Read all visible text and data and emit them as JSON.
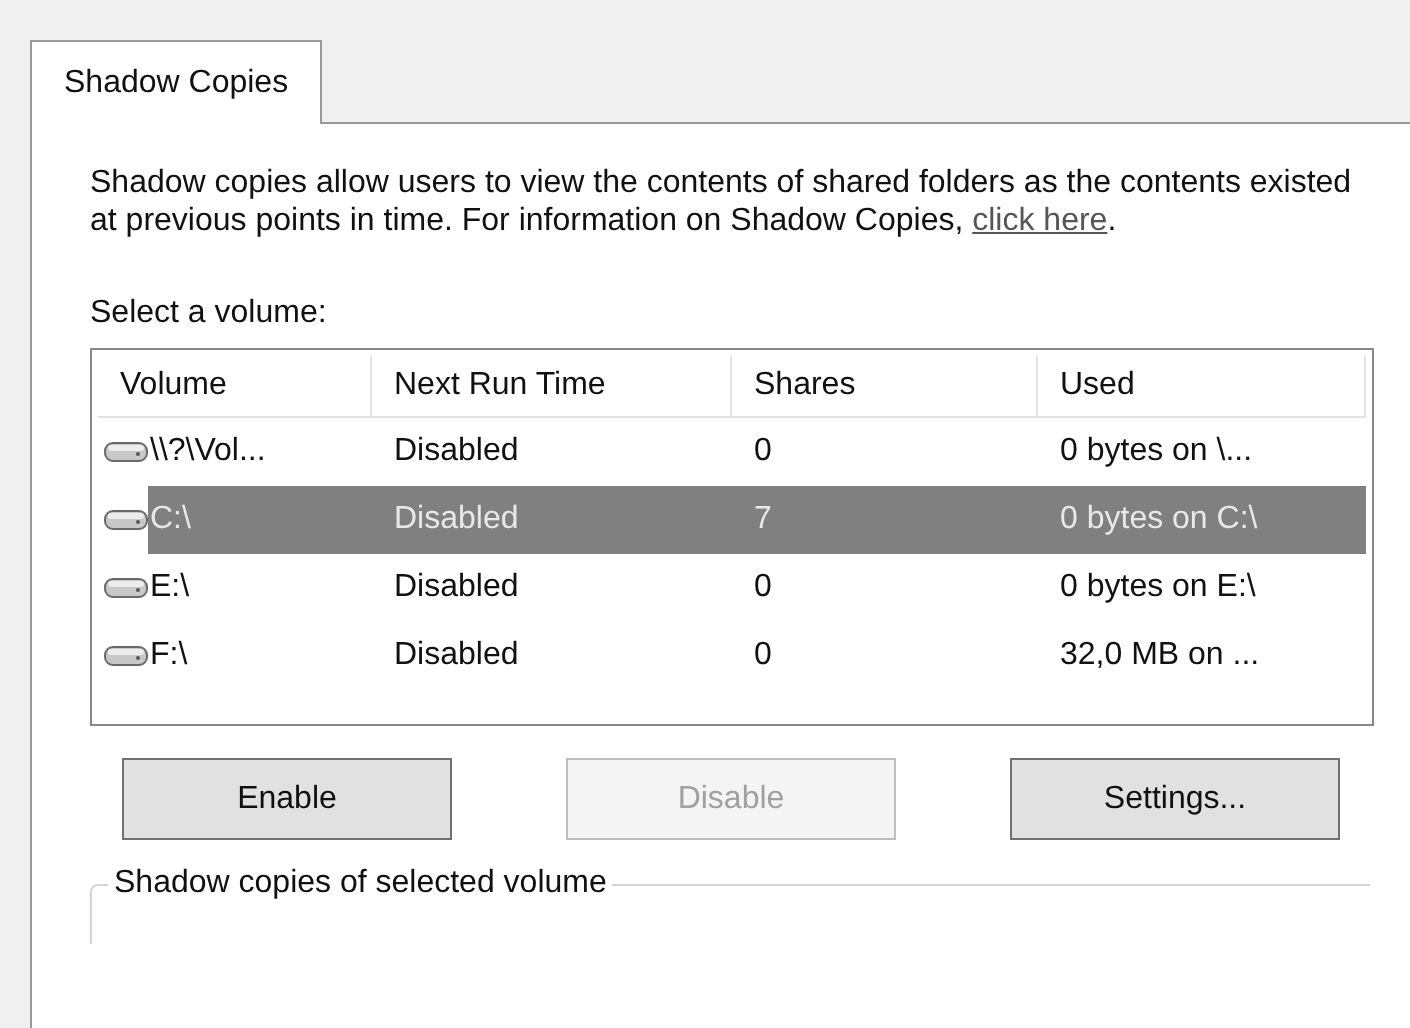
{
  "tabs": [
    {
      "label": "Shadow Copies",
      "selected": true
    }
  ],
  "description": {
    "text": "Shadow copies allow users to view the contents of shared folders as the contents existed at previous points in time. For information on Shadow Copies, ",
    "link": "click here",
    "after": "."
  },
  "volume_label": "Select a volume:",
  "table": {
    "columns": [
      "Volume",
      "Next Run Time",
      "Shares",
      "Used"
    ],
    "rows": [
      {
        "cells": [
          "\\\\?\\Vol...",
          "Disabled",
          "0",
          "0 bytes on \\..."
        ],
        "selected": false
      },
      {
        "cells": [
          "C:\\",
          "Disabled",
          "7",
          "0 bytes on C:\\"
        ],
        "selected": true
      },
      {
        "cells": [
          "E:\\",
          "Disabled",
          "0",
          "0 bytes on E:\\"
        ],
        "selected": false
      },
      {
        "cells": [
          "F:\\",
          "Disabled",
          "0",
          "32,0 MB on ..."
        ],
        "selected": false
      }
    ]
  },
  "buttons": [
    {
      "label": "Enable",
      "disabled": false
    },
    {
      "label": "Disable",
      "disabled": true
    },
    {
      "label": "Settings...",
      "disabled": false
    }
  ],
  "group_title": "Shadow copies of selected volume"
}
